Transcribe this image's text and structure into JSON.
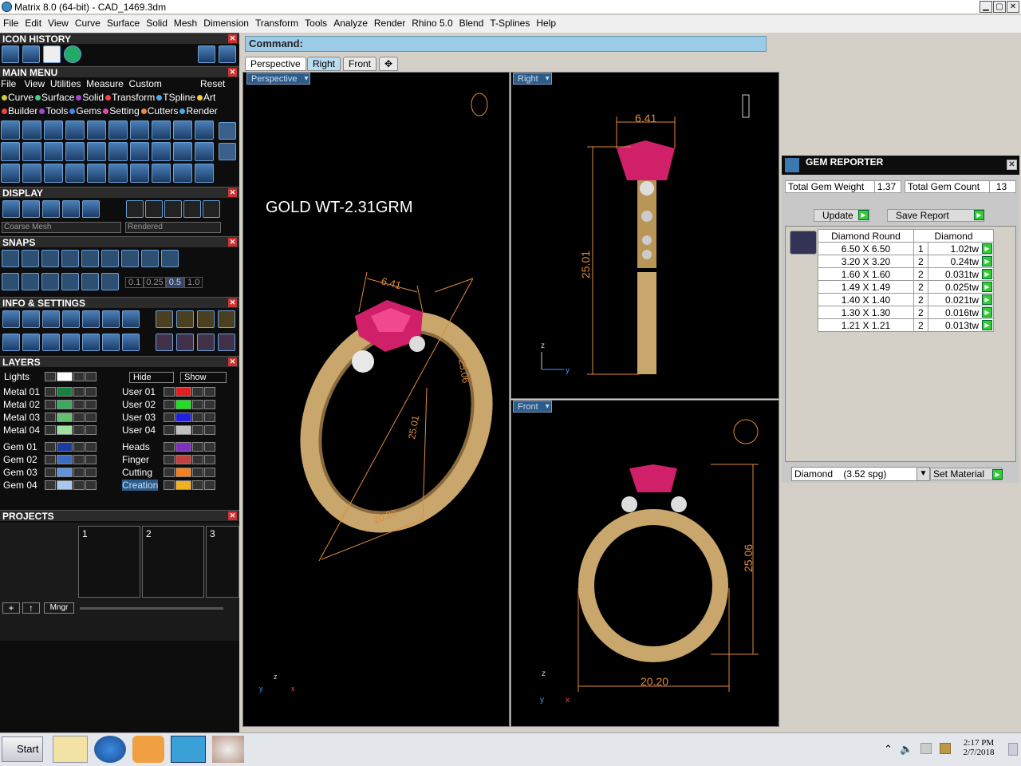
{
  "window": {
    "title": "Matrix 8.0 (64-bit) - CAD_1469.3dm"
  },
  "menu": [
    "File",
    "Edit",
    "View",
    "Curve",
    "Surface",
    "Solid",
    "Mesh",
    "Dimension",
    "Transform",
    "Tools",
    "Analyze",
    "Render",
    "Rhino 5.0",
    "Blend",
    "T-Splines",
    "Help"
  ],
  "left": {
    "icon_history": "ICON HISTORY",
    "main_menu": "MAIN MENU",
    "main_menu_items": [
      "File",
      "View",
      "Utilities",
      "Measure",
      "Custom"
    ],
    "reset": "Reset",
    "row1": [
      "Curve",
      "Surface",
      "Solid",
      "Transform",
      "TSpline",
      "Art"
    ],
    "row2": [
      "Builder",
      "Tools",
      "Gems",
      "Setting",
      "Cutters",
      "Render"
    ],
    "display": "DISPLAY",
    "mesh_select": "Coarse Mesh",
    "render_select": "Rendered",
    "snaps": "SNAPS",
    "snap_values": [
      "0.1",
      "0.25",
      "0.5",
      "1.0"
    ],
    "info_settings": "INFO & SETTINGS",
    "layers": "LAYERS",
    "lights": "Lights",
    "hide": "Hide",
    "show": "Show",
    "layers_left": [
      "Metal 01",
      "Metal 02",
      "Metal 03",
      "Metal 04",
      "Gem 01",
      "Gem 02",
      "Gem 03",
      "Gem 04"
    ],
    "layers_right": [
      "User 01",
      "User 02",
      "User 03",
      "User 04",
      "Heads",
      "Finger",
      "Cutting",
      "Creation"
    ],
    "projects": "PROJECTS",
    "project_slots": [
      "1",
      "2",
      "3"
    ],
    "mngr": "Mngr"
  },
  "command": {
    "label": "Command:"
  },
  "tabs": [
    "Perspective",
    "Right",
    "Front",
    "✥"
  ],
  "viewports": {
    "perspective": {
      "label": "Perspective",
      "annotation": "GOLD WT-2.31GRM",
      "dim_top": "6.41",
      "dim_height": "25.06",
      "dim_mid": "25.01",
      "dim_bottom": "20.20"
    },
    "right": {
      "label": "Right",
      "dim_top": "6.41",
      "dim_height": "25.01"
    },
    "front": {
      "label": "Front",
      "dim_height": "25.06",
      "dim_width": "20.20"
    }
  },
  "gem_reporter": {
    "title": "GEM REPORTER",
    "total_weight_label": "Total Gem Weight",
    "total_weight": "1.37",
    "total_count_label": "Total Gem Count",
    "total_count": "13",
    "update": "Update",
    "save_report": "Save Report",
    "col1": "Diamond Round",
    "col2": "Diamond",
    "rows": [
      [
        "6.50 X 6.50",
        "1",
        "1.02tw"
      ],
      [
        "3.20 X 3.20",
        "2",
        "0.24tw"
      ],
      [
        "1.60 X 1.60",
        "2",
        "0.031tw"
      ],
      [
        "1.49 X 1.49",
        "2",
        "0.025tw"
      ],
      [
        "1.40 X 1.40",
        "2",
        "0.021tw"
      ],
      [
        "1.30 X 1.30",
        "2",
        "0.016tw"
      ],
      [
        "1.21 X 1.21",
        "2",
        "0.013tw"
      ]
    ],
    "material": "Diamond    (3.52 spg)",
    "set_material": "Set Material"
  },
  "taskbar": {
    "start": "Start",
    "time": "2:17 PM",
    "date": "2/7/2018"
  }
}
